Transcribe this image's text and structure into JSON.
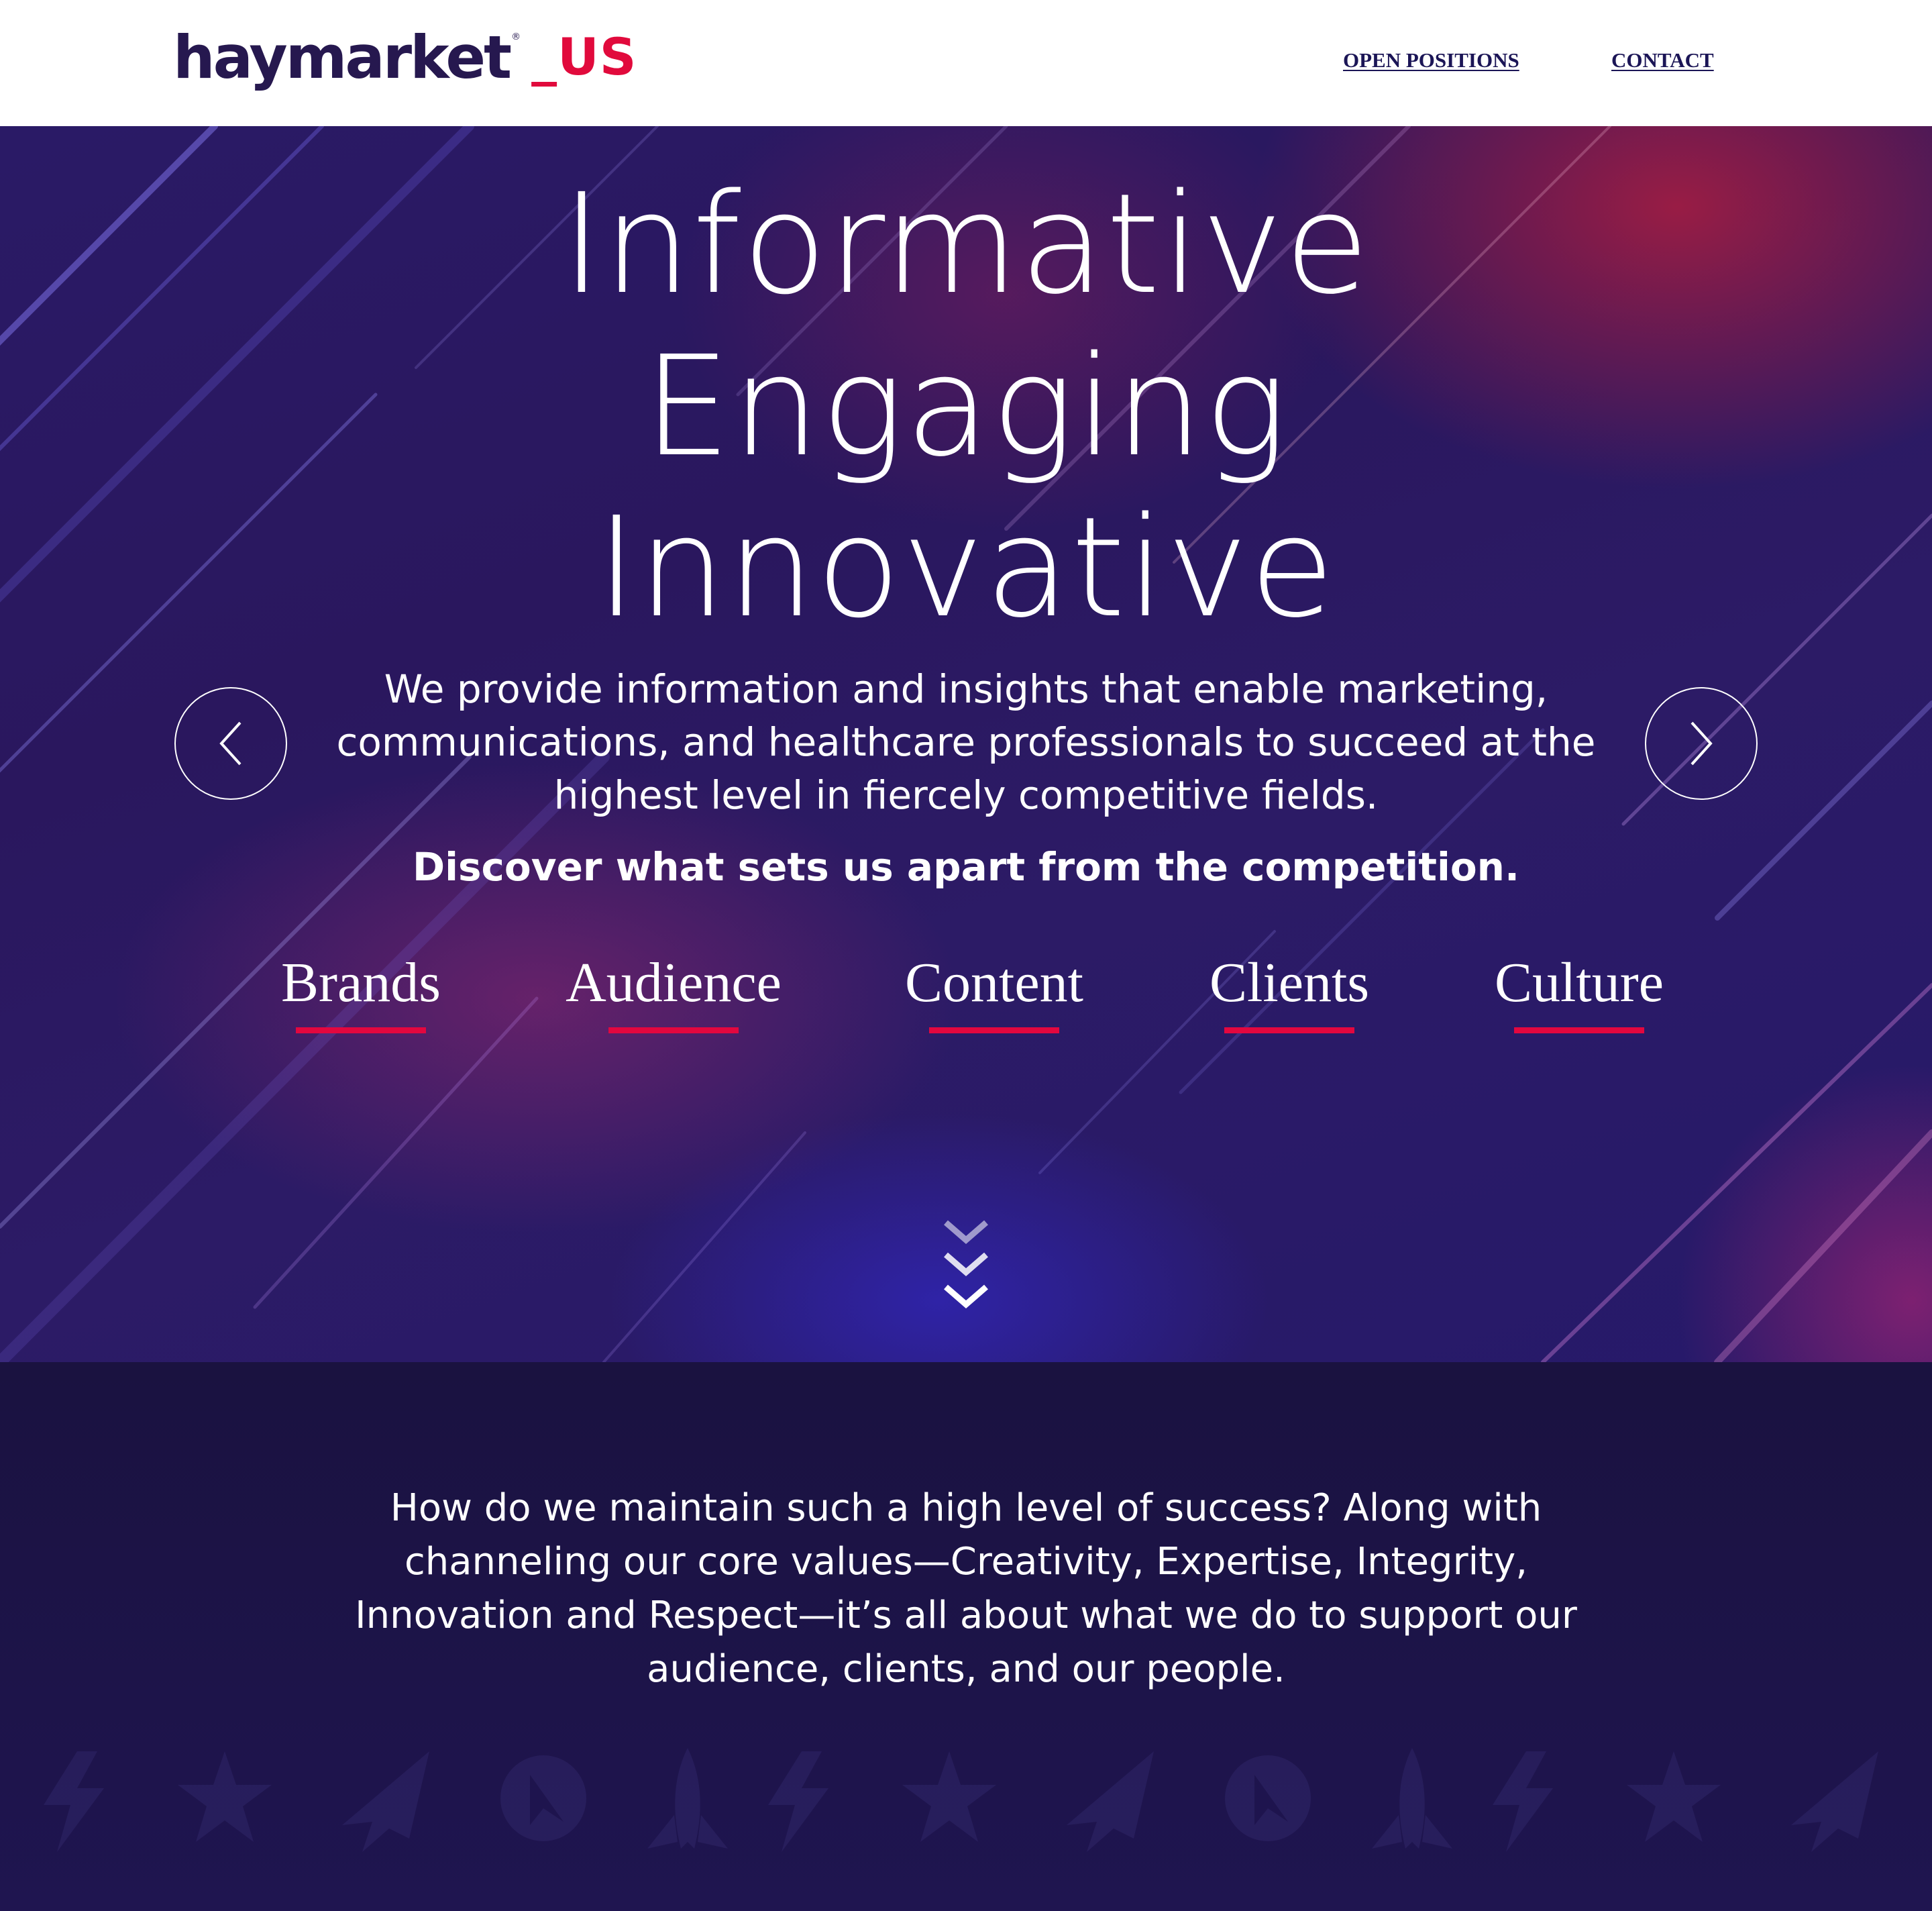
{
  "header": {
    "logo_text": "haymarket",
    "logo_reg": "®",
    "logo_suffix": "_US",
    "nav": {
      "open_positions": "OPEN POSITIONS",
      "contact": "CONTACT"
    }
  },
  "hero": {
    "headline_lines": [
      "Informative",
      "Engaging",
      "Innovative"
    ],
    "intro": "We provide information and insights that enable marketing, communications, and healthcare professionals to succeed at the highest level in fiercely competitive fields.",
    "tagline": "Discover what sets us apart from the competition.",
    "pillars": [
      "Brands",
      "Audience",
      "Content",
      "Clients",
      "Culture"
    ],
    "icons": {
      "prev": "chevron-left-icon",
      "next": "chevron-right-icon",
      "scroll": "triple-chevron-down-icon"
    }
  },
  "values": {
    "text": "How do we maintain such a high level of success? Along with channeling our core values—Creativity, Expertise, Integrity, Innovation and Respect—it’s all about what we do to support our audience, clients, and our people.",
    "icons": [
      "lightning-icon",
      "star-icon",
      "paper-plane-icon",
      "compass-icon",
      "rocket-icon"
    ]
  },
  "colors": {
    "brand_navy": "#26184f",
    "brand_red": "#e10a3c",
    "section_dark": "#1c1344"
  }
}
